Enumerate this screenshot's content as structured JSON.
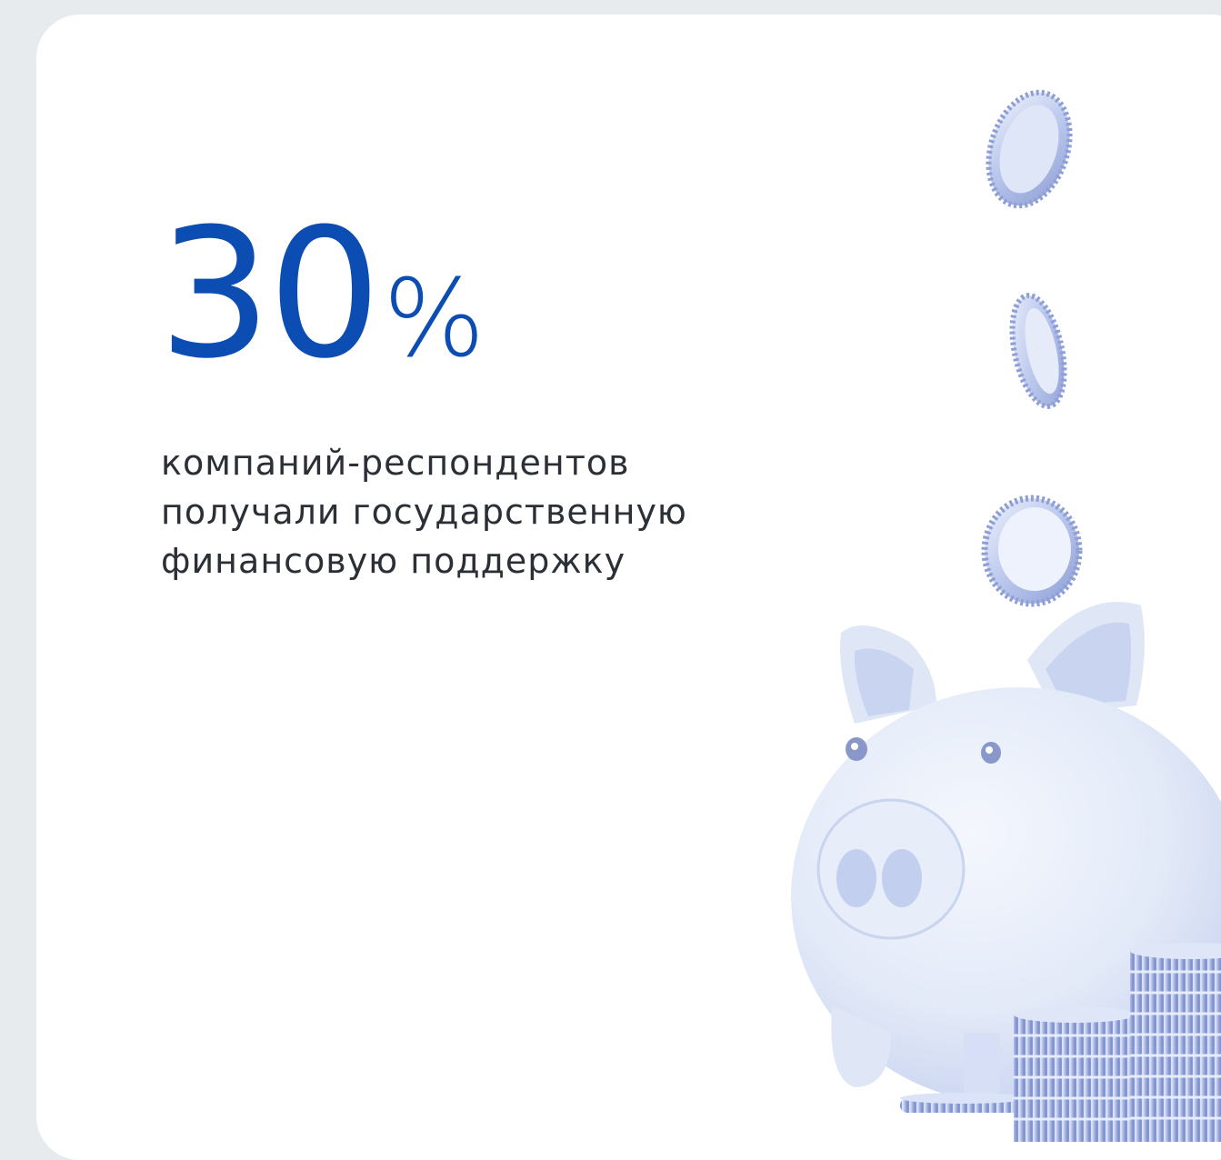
{
  "stat": {
    "value": "30",
    "unit": "%"
  },
  "description": {
    "line1": "компаний-респондентов",
    "line2": "получали государственную",
    "line3": "финансовую поддержку"
  },
  "illustration": {
    "icon": "piggy-bank-with-coins",
    "colors": {
      "accent": "#0b4db3",
      "coin": "#b7c3ea",
      "coin_dark": "#8e9fd6",
      "pig": "#e6ecf8"
    }
  }
}
